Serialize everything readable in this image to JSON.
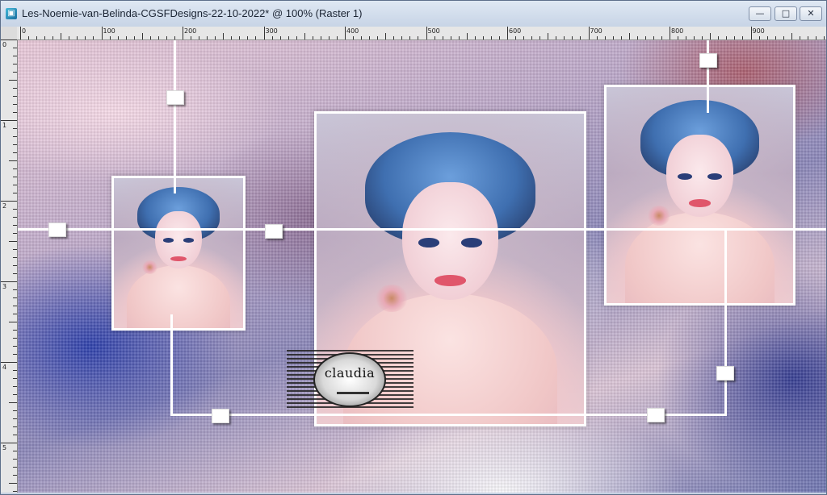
{
  "window": {
    "title": "Les-Noemie-van-Belinda-CGSFDesigns-22-10-2022* @ 100% (Raster 1)",
    "app_icon_glyph": "▣",
    "buttons": {
      "minimize": "—",
      "maximize": "□",
      "close": "✕"
    }
  },
  "ruler": {
    "top_labels": [
      "0",
      "100",
      "200",
      "300",
      "400",
      "500",
      "600",
      "700",
      "800",
      "900"
    ],
    "left_labels": [
      "0",
      "1",
      "2",
      "3",
      "4",
      "5"
    ]
  },
  "watermark": {
    "text": "claudia"
  },
  "icons": [
    "app-icon",
    "minimize-icon",
    "maximize-icon",
    "close-icon"
  ]
}
